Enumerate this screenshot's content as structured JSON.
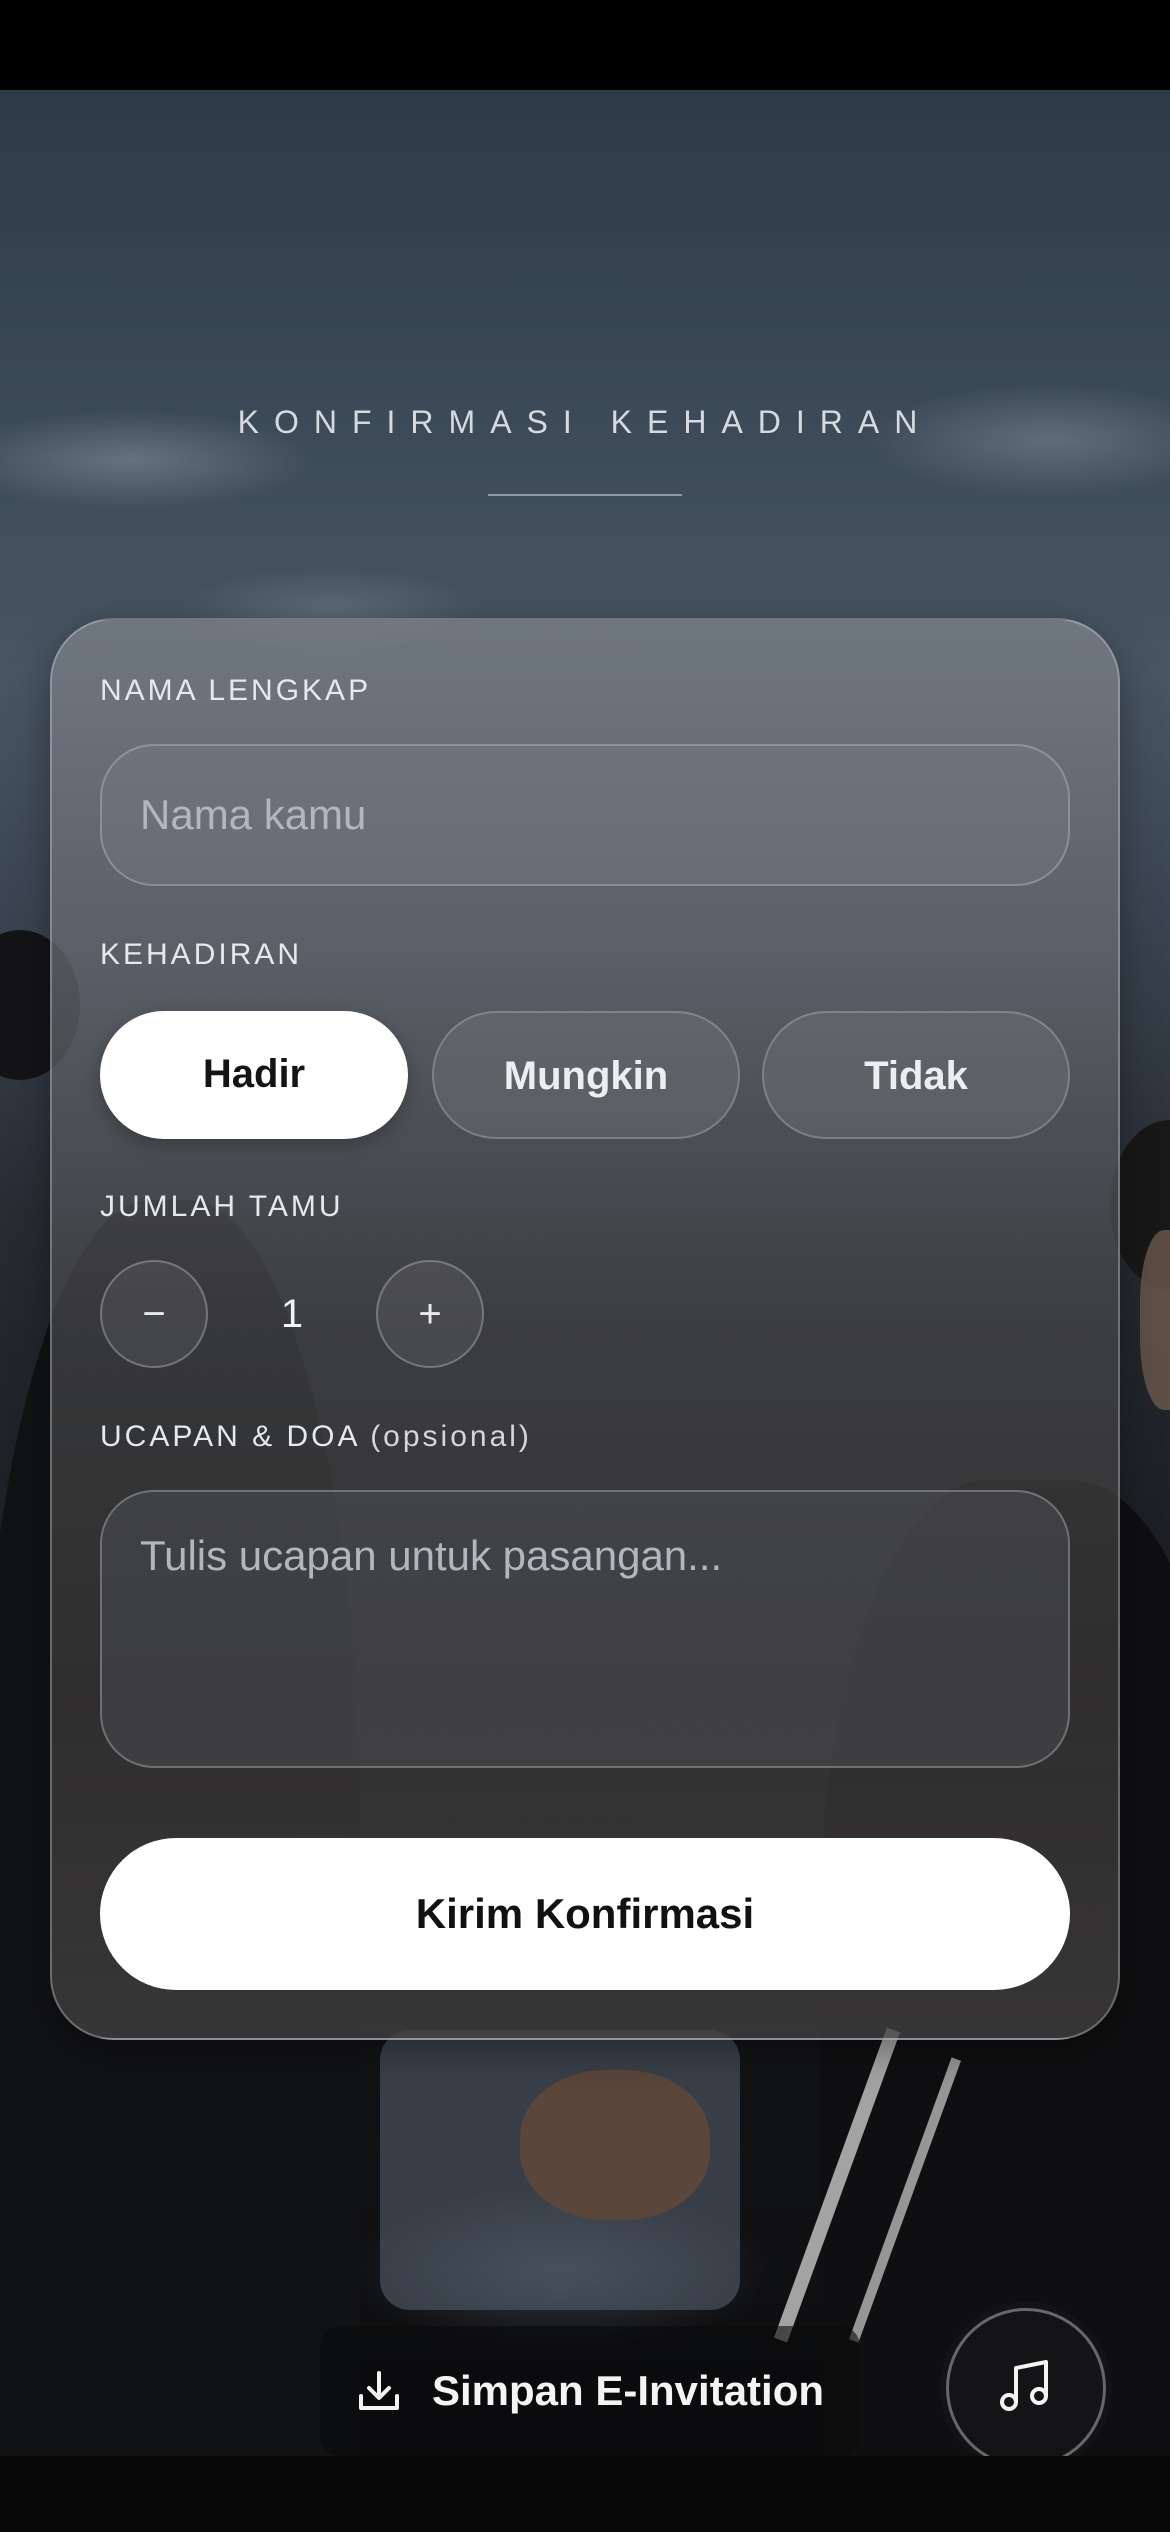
{
  "section": {
    "title": "KONFIRMASI KEHADIRAN"
  },
  "form": {
    "name_label": "NAMA LENGKAP",
    "name_placeholder": "Nama kamu",
    "attendance_label": "KEHADIRAN",
    "attendance_options": [
      "Hadir",
      "Mungkin",
      "Tidak"
    ],
    "attendance_selected": "Hadir",
    "guests_label": "JUMLAH TAMU",
    "guests_decrement": "−",
    "guests_value": "1",
    "guests_increment": "+",
    "message_label": "UCAPAN & DOA",
    "message_label_optional": "(opsional)",
    "message_placeholder": "Tulis ucapan untuk pasangan...",
    "submit_label": "Kirim Konfirmasi"
  },
  "footer": {
    "save_label": "Simpan E-Invitation",
    "save_icon": "download-icon",
    "music_icon": "music-note-icon"
  },
  "colors": {
    "primary_button": "#ffffff",
    "primary_button_text": "#111111",
    "label_text": "#e6e8eb"
  }
}
